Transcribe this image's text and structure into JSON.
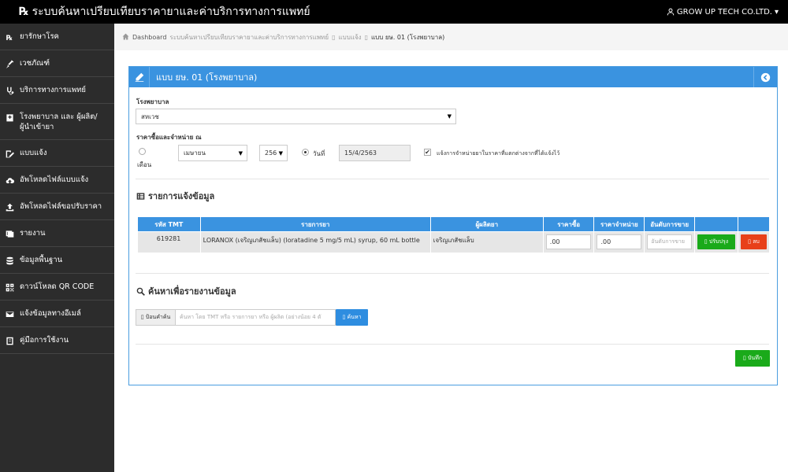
{
  "app": {
    "logo_symbol": "℞",
    "title": "ระบบค้นหาเปรียบเทียบราคายาและค่าบริการทางการแพทย์",
    "user": "GROW UP TECH CO.LTD.",
    "user_caret": "▾"
  },
  "sidebar": {
    "items": [
      {
        "label": "ยารักษาโรค",
        "icon": "rx-icon"
      },
      {
        "label": "เวชภัณฑ์",
        "icon": "syringe-icon"
      },
      {
        "label": "บริการทางการแพทย์",
        "icon": "stethoscope-icon"
      },
      {
        "label": "โรงพยาบาล และ ผู้ผลิต/ผู้นำเข้ายา",
        "icon": "hospital-icon"
      },
      {
        "label": "แบบแจ้ง",
        "icon": "edit-form-icon"
      },
      {
        "label": "อัพโหลดไฟล์แบบแจ้ง",
        "icon": "cloud-upload-icon"
      },
      {
        "label": "อัพโหลดไฟล์ขอปรับราคา",
        "icon": "upload-icon"
      },
      {
        "label": "รายงาน",
        "icon": "report-icon"
      },
      {
        "label": "ข้อมูลพื้นฐาน",
        "icon": "database-icon"
      },
      {
        "label": "ดาวน์โหลด QR CODE",
        "icon": "qrcode-icon"
      },
      {
        "label": "แจ้งข้อมูลทางอีเมล์",
        "icon": "email-icon"
      },
      {
        "label": "คู่มือการใช้งาน",
        "icon": "manual-icon"
      }
    ]
  },
  "breadcrumb": {
    "home": "Dashboard",
    "level1": "ระบบค้นหาเปรียบเทียบราคายาและค่าบริการทางการแพทย์",
    "level2": "แบบแจ้ง",
    "current": "แบบ ยษ. 01 (โรงพยาบาล)",
    "separator": "▯"
  },
  "panel": {
    "title": "แบบ ยษ. 01 (โรงพยาบาล)"
  },
  "form": {
    "hospital_label": "โรงพยาบาล",
    "hospital_value": "สหเวช",
    "price_label": "ราคาซื้อและจำหน่าย ณ",
    "month_radio_label": "เดือน",
    "month_value": "เมษายน",
    "year_value": "256",
    "date_radio_label": "วันที่",
    "date_value": "15/4/2563",
    "notify_check_label": "แจ้งการจำหน่ายยาในราคาที่แตกต่างจากที่ได้แจ้งไว้",
    "check_mark": "✔",
    "caret": "▼"
  },
  "items_section": {
    "title": "รายการแจ้งข้อมูล",
    "columns": [
      "รหัส TMT",
      "รายการยา",
      "ผู้ผลิตยา",
      "ราคาซื้อ",
      "ราคาจำหน่าย",
      "อันดับการขาย",
      "",
      ""
    ],
    "rows": [
      {
        "tmt": "619281",
        "drug": "LORANOX (เจริญเภสัชแล็บ) (loratadine 5 mg/5 mL) syrup, 60 mL bottle",
        "maker": "เจริญเภสัชแล็บ",
        "buy_price": ".00",
        "sell_price": ".00",
        "rank_placeholder": "อันดับการขาย",
        "update_label": "▯ ปรับปรุง",
        "delete_label": "▯ ลบ"
      }
    ]
  },
  "search_section": {
    "title": "ค้นหาเพื่อรายงานข้อมูล",
    "addon": "▯ ป้อนคำค้น",
    "placeholder": "ค้นหา โดย TMT หรือ รายการยา  หรือ ผู้ผลิต (อย่างน้อย 4 ตั",
    "button": "▯ ค้นหา"
  },
  "save_button": "▯ บันทึก",
  "colors": {
    "topbar": "#000000",
    "sidebar": "#2c2c2c",
    "accent": "#3a93e0",
    "green": "#1aaa1a",
    "red": "#e8401a"
  }
}
